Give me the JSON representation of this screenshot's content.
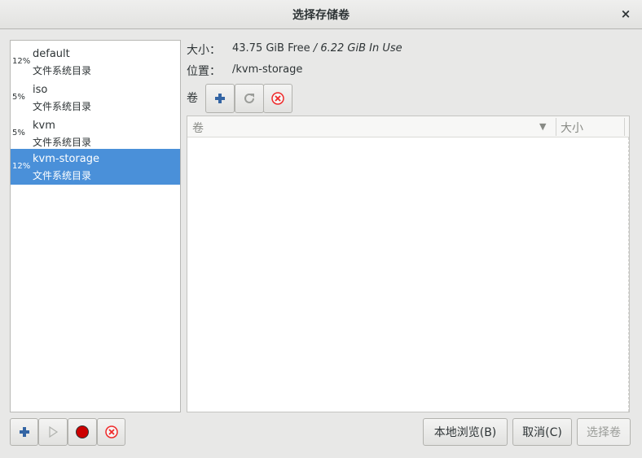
{
  "window": {
    "title": "选择存储卷",
    "close_glyph": "×"
  },
  "pools": [
    {
      "percent": "12%",
      "name": "default",
      "type": "文件系统目录",
      "selected": false
    },
    {
      "percent": "5%",
      "name": "iso",
      "type": "文件系统目录",
      "selected": false
    },
    {
      "percent": "5%",
      "name": "kvm",
      "type": "文件系统目录",
      "selected": false
    },
    {
      "percent": "12%",
      "name": "kvm-storage",
      "type": "文件系统目录",
      "selected": true
    }
  ],
  "details": {
    "size_label": "大小：",
    "size_free": "43.75 GiB Free",
    "size_sep": " / ",
    "size_used": "6.22 GiB In Use",
    "location_label": "位置：",
    "location_value": "/kvm-storage",
    "volumes_label": "卷"
  },
  "volume_table": {
    "columns": [
      "卷",
      "大小"
    ],
    "sort_glyph": "▼",
    "rows": []
  },
  "buttons": {
    "browse_local": "本地浏览(B)",
    "cancel": "取消(C)",
    "choose_volume": "选择卷"
  },
  "icons": {
    "add_volume": "add-icon",
    "refresh_volumes": "refresh-icon",
    "delete_volume": "delete-icon",
    "add_pool": "add-icon",
    "start_pool": "play-icon",
    "stop_pool": "stop-icon",
    "delete_pool": "delete-icon"
  },
  "colors": {
    "selection": "#4a90d9",
    "add_blue": "#3465a4",
    "stop_red": "#cc0000",
    "delete_red": "#ef2929"
  }
}
